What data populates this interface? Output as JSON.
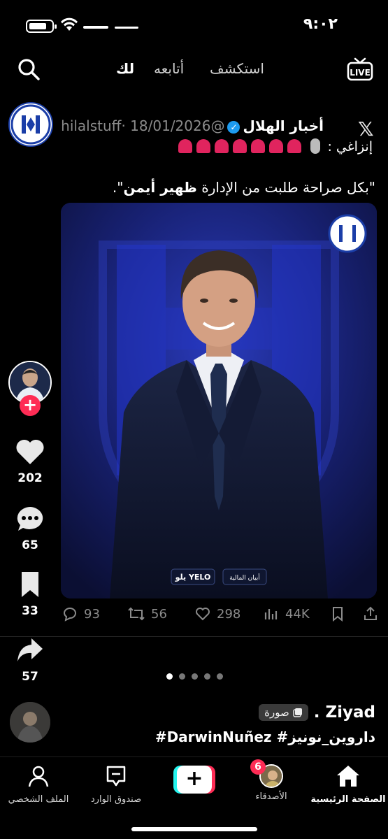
{
  "status_bar": {
    "time": "٩:٠٢"
  },
  "top_nav": {
    "tabs": [
      {
        "label": "استكشف"
      },
      {
        "label": "أتابعه"
      },
      {
        "label": "لك"
      }
    ],
    "live_label": "LIVE"
  },
  "tweet": {
    "name": "أخبار الهلال",
    "handle": "@hilalstuff",
    "date": "· 18/01/2026",
    "alert_label": "إنزاغي :",
    "text_before": "\"بكل صراحة طلبت من الإدارة ",
    "text_bold": "ظهير أيمن",
    "text_after": "\".",
    "image_sponsor_1": "يلو YELO",
    "image_sponsor_2": "أبيان المالية",
    "replies": "93",
    "retweets": "56",
    "likes": "298",
    "views": "44K"
  },
  "rail": {
    "likes": "202",
    "comments": "65",
    "saves": "33",
    "shares": "57",
    "follow_symbol": "+"
  },
  "carousel": {
    "total": 5,
    "active": 0
  },
  "caption": {
    "username": "Ziyad .",
    "photo_badge": "صورة",
    "hashtags": "داروين_نونيز# DarwinNuñez#"
  },
  "bottom_nav": {
    "home": "الصفحة الرئيسية",
    "friends": "الأصدقاء",
    "friends_badge": "6",
    "create": "+",
    "inbox": "صندوق الوارد",
    "profile": "الملف الشخصي"
  },
  "colors": {
    "accent_red": "#fe2c55",
    "accent_cyan": "#25f4ee",
    "verified_blue": "#1d9bf0",
    "hilal_blue": "#1b3ea8"
  }
}
